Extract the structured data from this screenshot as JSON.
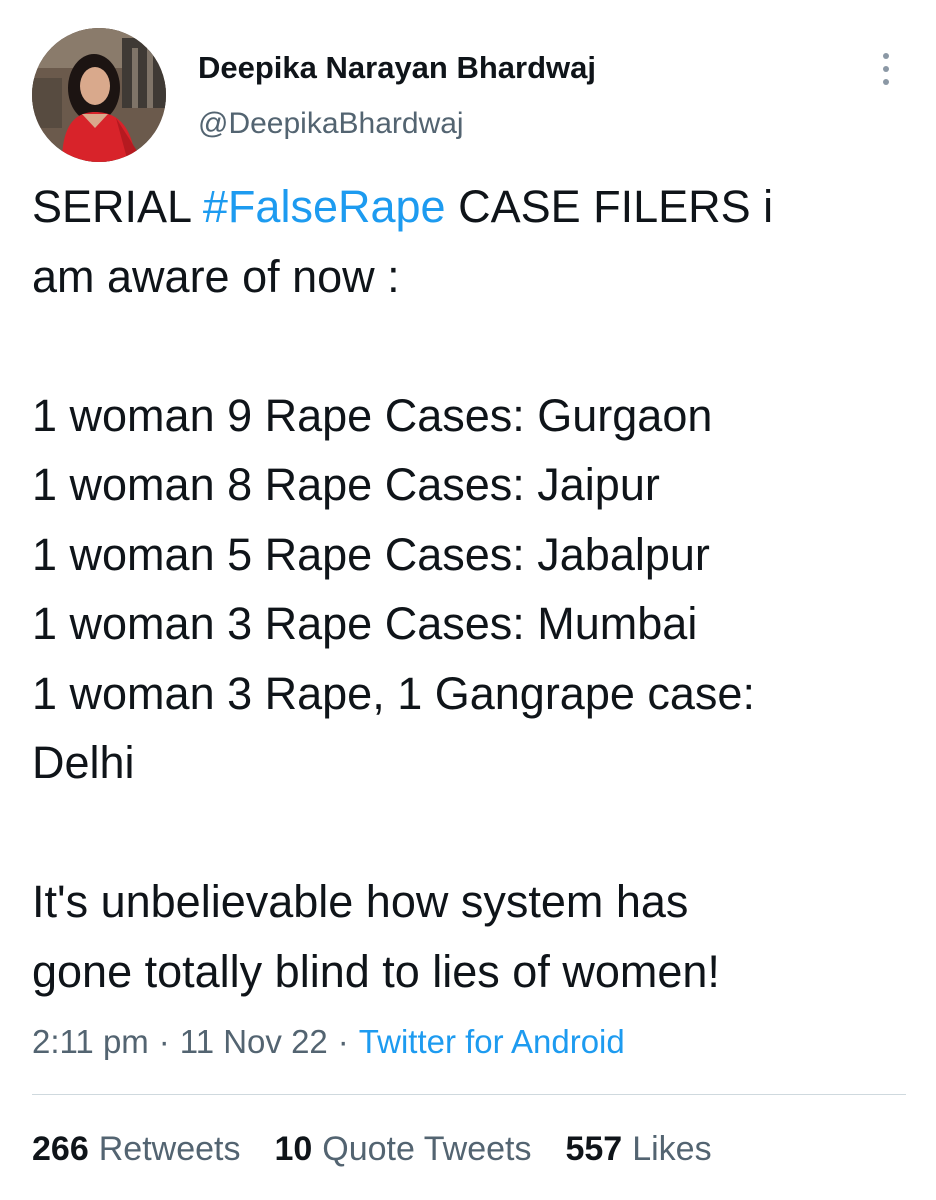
{
  "author": {
    "display_name": "Deepika Narayan Bhardwaj",
    "handle": "@DeepikaBhardwaj"
  },
  "tweet": {
    "line1_prefix": "SERIAL ",
    "hashtag": "#FalseRape",
    "line1_suffix": " CASE FILERS i",
    "line2": "am aware of now :",
    "list": [
      "1 woman 9 Rape Cases: Gurgaon",
      "1 woman 8 Rape Cases: Jaipur",
      "1 woman 5 Rape Cases: Jabalpur",
      "1 woman 3 Rape Cases: Mumbai",
      "1 woman 3 Rape, 1 Gangrape case:",
      "Delhi"
    ],
    "closing": [
      "It's unbelievable how system has",
      "gone totally blind to lies of women!"
    ]
  },
  "meta": {
    "time": "2:11 pm",
    "separator": "·",
    "date": "11 Nov 22",
    "source": "Twitter for Android"
  },
  "stats": {
    "retweets_count": "266",
    "retweets_label": "Retweets",
    "quotes_count": "10",
    "quotes_label": "Quote Tweets",
    "likes_count": "557",
    "likes_label": "Likes"
  },
  "colors": {
    "link_blue": "#1d9bf0",
    "text_primary": "#0f1419",
    "text_secondary": "#536471",
    "divider": "#cfd9de"
  },
  "icons": {
    "more": "more-vertical-icon"
  }
}
